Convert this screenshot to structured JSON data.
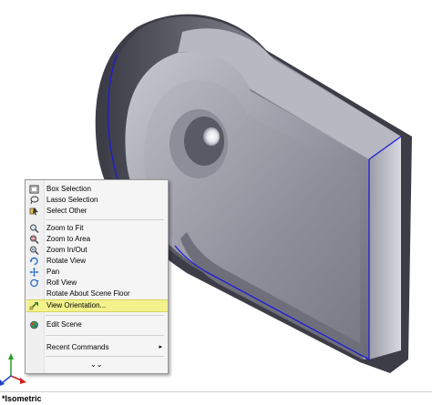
{
  "context_menu": {
    "items": [
      {
        "label": "Box Selection",
        "icon": "box-selection-icon"
      },
      {
        "label": "Lasso Selection",
        "icon": "lasso-selection-icon"
      },
      {
        "label": "Select Other",
        "icon": "select-other-icon"
      },
      {
        "label": "Zoom to Fit",
        "icon": "zoom-to-fit-icon"
      },
      {
        "label": "Zoom to Area",
        "icon": "zoom-to-area-icon"
      },
      {
        "label": "Zoom In/Out",
        "icon": "zoom-in-out-icon"
      },
      {
        "label": "Rotate View",
        "icon": "rotate-view-icon"
      },
      {
        "label": "Pan",
        "icon": "pan-icon"
      },
      {
        "label": "Roll View",
        "icon": "roll-view-icon"
      },
      {
        "label": "Rotate About Scene Floor",
        "icon": ""
      },
      {
        "label": "View Orientation...",
        "icon": "view-orientation-icon",
        "highlighted": true
      },
      {
        "label": "Edit Scene",
        "icon": "edit-scene-icon"
      },
      {
        "label": "Recent Commands",
        "icon": "",
        "submenu": true
      }
    ],
    "submenu_arrow": "▸",
    "expand_chevron": "⌄⌄"
  },
  "status": {
    "view_name": "*Isometric"
  },
  "colors": {
    "part_face": "#a6a6b2",
    "part_shadow": "#55555f",
    "edge_highlight": "#1c1cd6",
    "menu_highlight": "#f3f28c"
  }
}
